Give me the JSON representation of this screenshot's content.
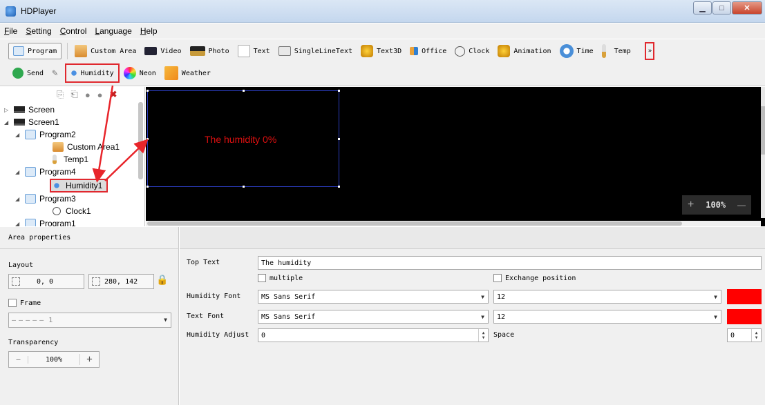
{
  "window": {
    "title": "HDPlayer"
  },
  "menu": [
    {
      "key": "F",
      "rest": "ile"
    },
    {
      "key": "S",
      "rest": "etting"
    },
    {
      "key": "C",
      "rest": "ontrol"
    },
    {
      "key": "L",
      "rest": "anguage"
    },
    {
      "key": "H",
      "rest": "elp"
    }
  ],
  "toolbar": {
    "program": "Program",
    "custom_area": "Custom Area",
    "video": "Video",
    "photo": "Photo",
    "text": "Text",
    "single_line_text": "SingleLineText",
    "text3d": "Text3D",
    "office": "Office",
    "clock": "Clock",
    "animation": "Animation",
    "time": "Time",
    "temp": "Temp",
    "more": "»",
    "send": "Send",
    "humidity": "Humidity",
    "neon": "Neon",
    "weather": "Weather"
  },
  "tree": {
    "nodes": [
      {
        "label": "Screen"
      },
      {
        "label": "Screen1"
      },
      {
        "label": "Program2"
      },
      {
        "label": "Custom Area1"
      },
      {
        "label": "Temp1"
      },
      {
        "label": "Program4"
      },
      {
        "label": "Humidity1"
      },
      {
        "label": "Program3"
      },
      {
        "label": "Clock1"
      },
      {
        "label": "Program1"
      }
    ]
  },
  "canvas": {
    "area_text": "The humidity 0%",
    "zoom": "100%",
    "zoom_plus": "+",
    "zoom_minus": "—"
  },
  "area_properties": {
    "header": "Area properties",
    "layout_label": "Layout",
    "position": "0, 0",
    "size": "280, 142",
    "frame_label": "Frame",
    "frame_value": "1",
    "transparency_label": "Transparency",
    "transparency_value": "100%",
    "minus": "—",
    "plus": "+"
  },
  "humidity_properties": {
    "top_text_label": "Top Text",
    "top_text_value": "The humidity",
    "multiple_label": "multiple",
    "exchange_label": "Exchange position",
    "humidity_font_label": "Humidity Font",
    "humidity_font_value": "MS Sans Serif",
    "humidity_font_size": "12",
    "text_font_label": "Text Font",
    "text_font_value": "MS Sans Serif",
    "text_font_size": "12",
    "adjust_label": "Humidity Adjust",
    "adjust_value": "0",
    "space_label": "Space",
    "space_value": "0",
    "font_color": "#ff0000"
  }
}
